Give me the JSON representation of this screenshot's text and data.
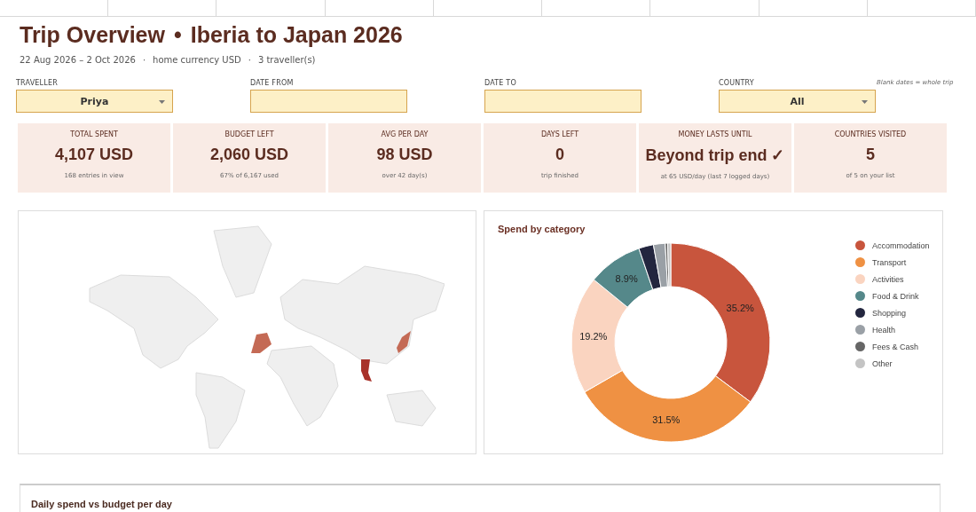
{
  "title": {
    "main": "Trip Overview",
    "separator": "•",
    "trip": "Iberia to Japan 2026"
  },
  "subtitle": [
    "22 Aug 2026 – 2 Oct 2026",
    "home currency USD",
    "3 traveller(s)"
  ],
  "subtitle_separator": "·",
  "filters": [
    {
      "kind": "dropdown",
      "label": "TRAVELLER",
      "value": "Priya"
    },
    {
      "kind": "date",
      "label": "DATE FROM"
    },
    {
      "kind": "date",
      "label": "DATE TO"
    },
    {
      "kind": "dropdown",
      "label": "COUNTRY",
      "value": "All"
    }
  ],
  "filter_note": "Blank dates = whole trip",
  "kpis": [
    {
      "label": "TOTAL SPENT",
      "value": "4,107 USD",
      "note": "168 entries in view"
    },
    {
      "label": "BUDGET LEFT",
      "value": "2,060 USD",
      "note": "67% of 6,167 used"
    },
    {
      "label": "AVG PER DAY",
      "value": "98 USD",
      "note": "over 42 day(s)"
    },
    {
      "label": "DAYS LEFT",
      "value": "0",
      "note": "trip finished"
    },
    {
      "label": "MONEY LASTS UNTIL",
      "value": "Beyond trip end ✓",
      "note": "at 65 USD/day (last 7 logged days)"
    },
    {
      "label": "COUNTRIES VISITED",
      "value": "5",
      "note": "of 5 on your list"
    }
  ],
  "category_chart": {
    "chart_data": {
      "type": "donut",
      "title": "Spend by category",
      "categories": [
        "Accommodation",
        "Transport",
        "Activities",
        "Food & Drink",
        "Shopping",
        "Health",
        "Fees & Cash",
        "Other"
      ],
      "values": [
        35.2,
        31.5,
        19.2,
        8.9,
        2.4,
        1.9,
        0.4,
        0.5
      ],
      "colors": [
        "#c8553d",
        "#ef9143",
        "#fad4c0",
        "#55888a",
        "#23263f",
        "#9aa0a6",
        "#666666",
        "#c4c4c4"
      ],
      "value_labels": [
        "35.2%",
        "31.5%",
        "19.2%",
        "8.9%",
        null,
        null,
        null,
        null
      ]
    }
  },
  "daily_panel": {
    "title": "Daily spend vs budget per day"
  }
}
